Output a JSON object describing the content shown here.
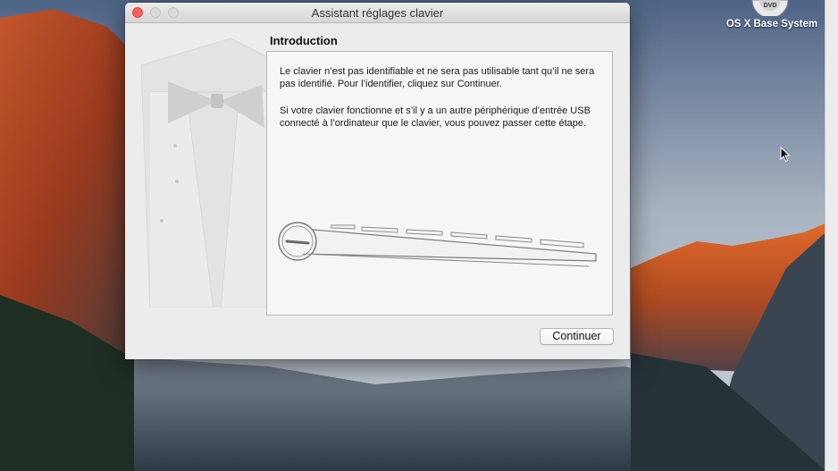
{
  "window": {
    "title": "Assistant réglages clavier"
  },
  "desktop": {
    "disk_label": "OS X Base System",
    "disk_icon": "dvd-disk-icon"
  },
  "content": {
    "section_title": "Introduction",
    "paragraph_1": "Le clavier n’est pas identifiable et ne sera pas utilisable tant qu’il ne sera pas identifié. Pour l’identifier, cliquez sur Continuer.",
    "paragraph_2": "Si votre clavier fonctionne et s’il y a un autre périphérique d’entrée USB connecté à l’ordinateur que le clavier, vous pouvez passer cette étape."
  },
  "buttons": {
    "continue_label": "Continuer"
  },
  "colors": {
    "close_button": "#fc605c",
    "window_bg": "#ececec",
    "content_bg": "#f6f6f6"
  }
}
